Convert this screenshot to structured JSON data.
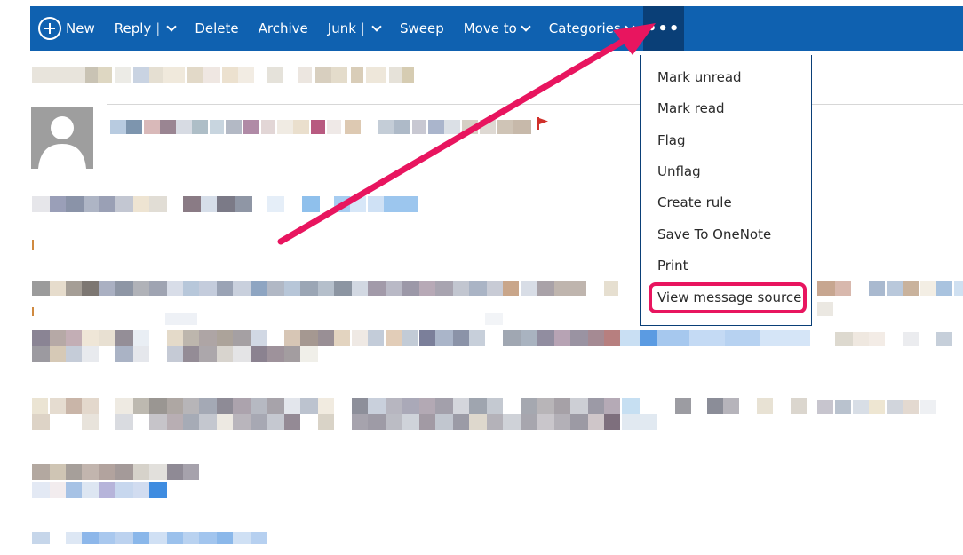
{
  "toolbar": {
    "new_label": "New",
    "reply_label": "Reply",
    "delete_label": "Delete",
    "archive_label": "Archive",
    "junk_label": "Junk",
    "sweep_label": "Sweep",
    "moveto_label": "Move to",
    "categories_label": "Categories",
    "more_label": "•••",
    "split_sep": "|"
  },
  "menu": {
    "items": [
      {
        "label": "Mark unread"
      },
      {
        "label": "Mark read"
      },
      {
        "label": "Flag"
      },
      {
        "label": "Unflag"
      },
      {
        "label": "Create rule"
      },
      {
        "label": "Save To OneNote"
      },
      {
        "label": "Print"
      },
      {
        "label": "View message source"
      }
    ]
  },
  "colors": {
    "toolbar_bg": "#0f61b0",
    "more_button_bg": "#0a3f77",
    "annotation": "#e8155f",
    "flag": "#d0302a"
  },
  "icons": {
    "new": "plus-circle-icon",
    "dropdown": "chevron-down-icon",
    "flag": "flag-icon",
    "avatar": "person-silhouette-icon"
  }
}
